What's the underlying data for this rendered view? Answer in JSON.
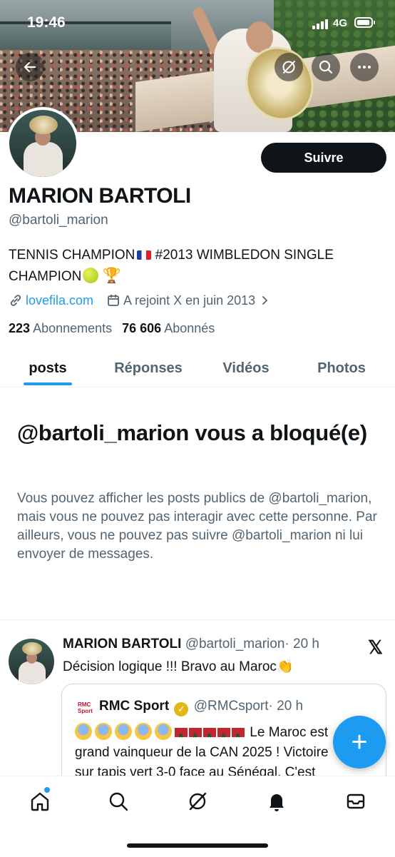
{
  "status_bar": {
    "time": "19:46",
    "network": "4G"
  },
  "profile": {
    "follow_label": "Suivre",
    "display_name": "MARION BARTOLI",
    "handle": "@bartoli_marion",
    "bio_line1": "TENNIS CHAMPION",
    "bio_line1b": " #2013 WIMBLEDON SINGLE",
    "bio_line2": "CHAMPION",
    "website": "lovefila.com",
    "joined": "A rejoint X en juin 2013",
    "following_count": "223",
    "following_label": "Abonnements",
    "followers_count": "76 606",
    "followers_label": "Abonnés"
  },
  "tabs": [
    {
      "label": "posts",
      "active": true
    },
    {
      "label": "Réponses",
      "active": false
    },
    {
      "label": "Vidéos",
      "active": false
    },
    {
      "label": "Photos",
      "active": false
    }
  ],
  "blocked": {
    "title": "@bartoli_marion vous a bloqué(e)",
    "text": "Vous pouvez afficher les posts publics de @bartoli_marion, mais vous ne pouvez pas interagir avec cette personne. Par ailleurs, vous ne pouvez pas suivre @bartoli_marion ni lui envoyer de messages."
  },
  "post": {
    "author": "MARION BARTOLI",
    "handle": "@bartoli_marion",
    "time": "· 20 h",
    "text": "Décision logique !!! Bravo au Maroc",
    "quote": {
      "logo": "RMC Sport",
      "author": "RMC Sport",
      "handle": "@RMCsport",
      "time": "· 20 h",
      "text_a": " Le Maroc est",
      "text_b": "grand vainqueur de la CAN 2025 ! Victoire",
      "text_c": "sur tapis vert 3-0 face au Sénégal. C'est"
    }
  },
  "fab_label": "+",
  "colors": {
    "accent": "#1d9bf0",
    "text": "#0f1419",
    "secondary": "#536471"
  }
}
